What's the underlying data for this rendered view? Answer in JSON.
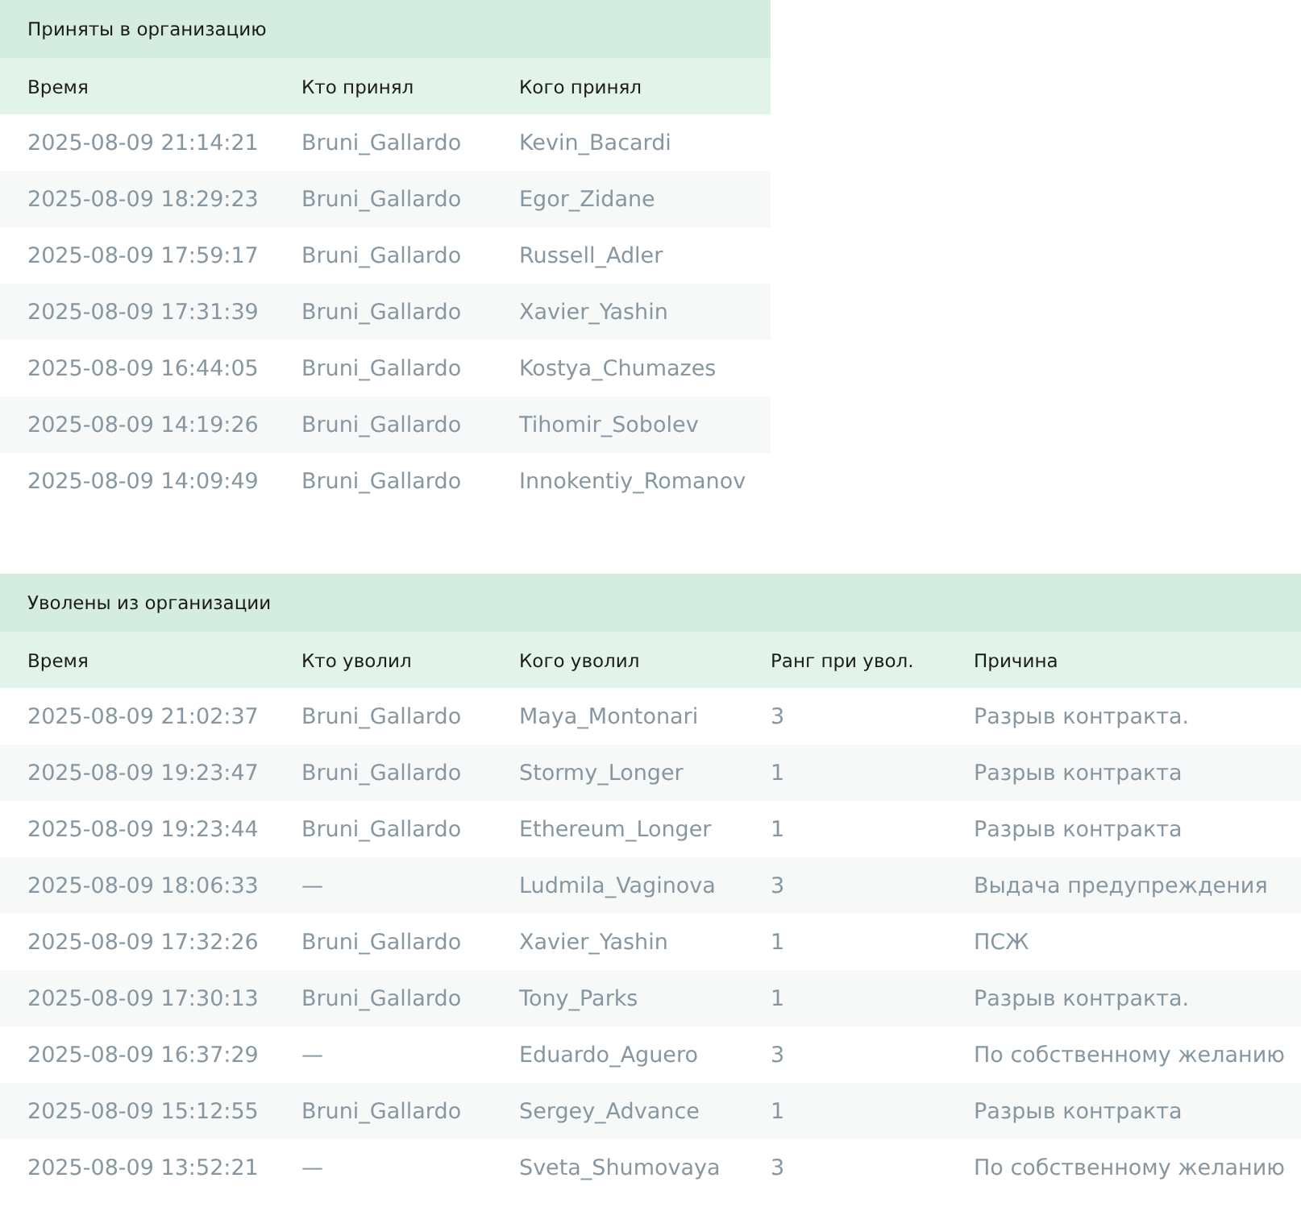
{
  "tables": [
    {
      "title": "Приняты в организацию",
      "columns": [
        "Время",
        "Кто принял",
        "Кого принял"
      ],
      "rows": [
        [
          "2025-08-09 21:14:21",
          "Bruni_Gallardo",
          "Kevin_Bacardi"
        ],
        [
          "2025-08-09 18:29:23",
          "Bruni_Gallardo",
          "Egor_Zidane"
        ],
        [
          "2025-08-09 17:59:17",
          "Bruni_Gallardo",
          "Russell_Adler"
        ],
        [
          "2025-08-09 17:31:39",
          "Bruni_Gallardo",
          "Xavier_Yashin"
        ],
        [
          "2025-08-09 16:44:05",
          "Bruni_Gallardo",
          "Kostya_Chumazes"
        ],
        [
          "2025-08-09 14:19:26",
          "Bruni_Gallardo",
          "Tihomir_Sobolev"
        ],
        [
          "2025-08-09 14:09:49",
          "Bruni_Gallardo",
          "Innokentiy_Romanov"
        ]
      ]
    },
    {
      "title": "Уволены из организации",
      "columns": [
        "Время",
        "Кто уволил",
        "Кого уволил",
        "Ранг при увол.",
        "Причина"
      ],
      "rows": [
        [
          "2025-08-09 21:02:37",
          "Bruni_Gallardo",
          "Maya_Montonari",
          "3",
          "Разрыв контракта."
        ],
        [
          "2025-08-09 19:23:47",
          "Bruni_Gallardo",
          "Stormy_Longer",
          "1",
          "Разрыв контракта"
        ],
        [
          "2025-08-09 19:23:44",
          "Bruni_Gallardo",
          "Ethereum_Longer",
          "1",
          "Разрыв контракта"
        ],
        [
          "2025-08-09 18:06:33",
          "—",
          "Ludmila_Vaginova",
          "3",
          "Выдача предупреждения"
        ],
        [
          "2025-08-09 17:32:26",
          "Bruni_Gallardo",
          "Xavier_Yashin",
          "1",
          "ПСЖ"
        ],
        [
          "2025-08-09 17:30:13",
          "Bruni_Gallardo",
          "Tony_Parks",
          "1",
          "Разрыв контракта."
        ],
        [
          "2025-08-09 16:37:29",
          "—",
          "Eduardo_Aguero",
          "3",
          "По собственному желанию"
        ],
        [
          "2025-08-09 15:12:55",
          "Bruni_Gallardo",
          "Sergey_Advance",
          "1",
          "Разрыв контракта"
        ],
        [
          "2025-08-09 13:52:21",
          "—",
          "Sveta_Shumovaya",
          "3",
          "По собственному желанию"
        ]
      ]
    }
  ]
}
